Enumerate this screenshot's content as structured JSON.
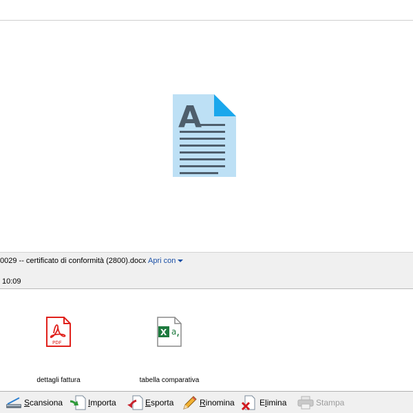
{
  "preview": {
    "file_name": "0029 -- certificato di conformità (2800).docx",
    "open_with_label": "Apri con",
    "time": "10:09"
  },
  "attachments": [
    {
      "label": "dettagli fattura",
      "icon": "pdf-file-icon",
      "badge": "PDF"
    },
    {
      "label": "tabella comparativa",
      "icon": "excel-file-icon",
      "badge": "X"
    }
  ],
  "toolbar": {
    "scan": {
      "first": "S",
      "rest": "cansiona"
    },
    "import": {
      "first": "I",
      "rest": "mporta"
    },
    "export": {
      "first": "E",
      "rest": "sporta"
    },
    "rename": {
      "first": "R",
      "rest": "inomina"
    },
    "delete": {
      "pre": "E",
      "first": "l",
      "rest": "imina"
    },
    "print": {
      "label": "Stampa",
      "enabled": false
    }
  },
  "colors": {
    "doc_icon": "#bde0f5",
    "doc_icon_fold": "#1aa7ec",
    "doc_icon_text": "#4e5e6c",
    "pdf_red": "#e0201b",
    "excel_green": "#1d7a3e",
    "link_blue": "#1a4fa6"
  }
}
